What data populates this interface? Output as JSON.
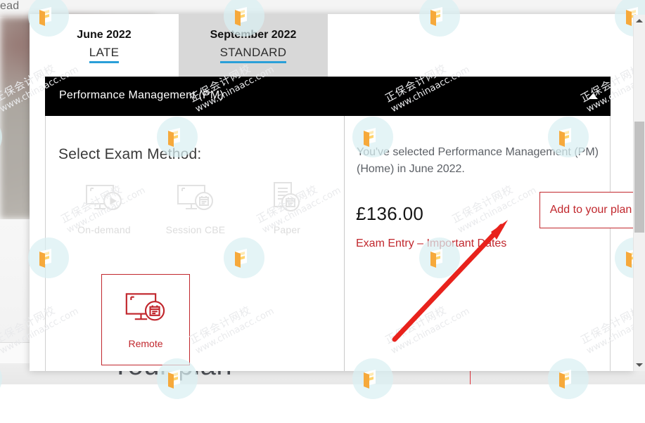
{
  "background": {
    "top_text": "ead",
    "lower_heading": "Your plan"
  },
  "watermark": {
    "cn_text": "正保会计网校",
    "en_text": "www.chinaacc.com"
  },
  "modal": {
    "tabs": [
      {
        "month": "June 2022",
        "type": "LATE",
        "active": true
      },
      {
        "month": "September 2022",
        "type": "STANDARD",
        "active": false
      }
    ],
    "subject": {
      "title": "Performance Management (PM)",
      "chevron": "chevron-up-icon",
      "expanded": true
    },
    "left_panel": {
      "heading": "Select Exam Method:",
      "methods": [
        {
          "label": "On-demand",
          "icon": "monitor-play-icon",
          "state": "disabled"
        },
        {
          "label": "Session CBE",
          "icon": "monitor-calendar-icon",
          "state": "disabled"
        },
        {
          "label": "Paper",
          "icon": "document-calendar-icon",
          "state": "disabled"
        }
      ],
      "selected_method": {
        "label": "Remote",
        "icon": "monitor-calendar-icon",
        "state": "selected"
      }
    },
    "right_panel": {
      "selection_text": "You've selected Performance Management (PM) (Home) in June 2022.",
      "price": "£136.00",
      "exam_entry_link": "Exam Entry – Important Dates",
      "add_button_label": "Add to your plan"
    }
  },
  "scrollbar": {
    "up_arrow": "scroll-up-icon",
    "down_arrow": "scroll-down-icon"
  },
  "colors": {
    "accent_red": "#c1272d",
    "tab_underline_blue": "#2a9fd8",
    "header_black": "#000000",
    "arrow_red": "#e8221c",
    "inactive_tab_grey": "#d8d8d8"
  }
}
